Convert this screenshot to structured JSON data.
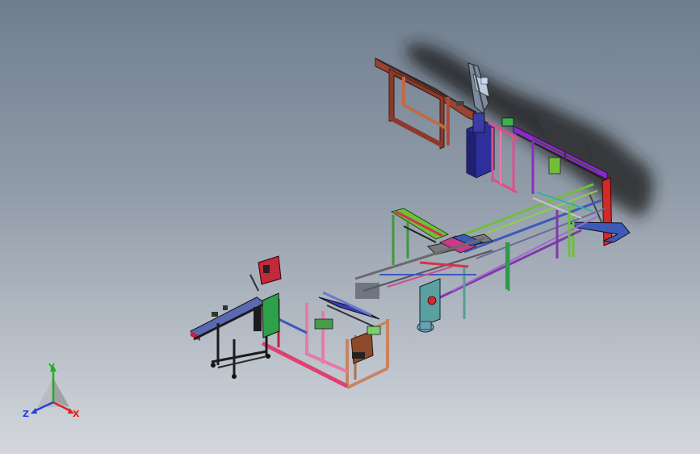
{
  "viewer": {
    "triad": {
      "x_label": "X",
      "y_label": "Y",
      "z_label": "Z"
    }
  },
  "colors": {
    "background_top": "#6f7e8f",
    "background_bottom": "#d4d8dd",
    "axis_x": "#e02020",
    "axis_y": "#20b020",
    "axis_z": "#2040e0",
    "frame_red": "#d2344b",
    "frame_brown": "#8b3a2a",
    "frame_purple": "#8a2cc4",
    "frame_green": "#6fbf3a",
    "frame_blue": "#3d5ab8",
    "frame_pink": "#e87aa6",
    "frame_black": "#1c1c1c",
    "frame_tan": "#c6845f"
  }
}
